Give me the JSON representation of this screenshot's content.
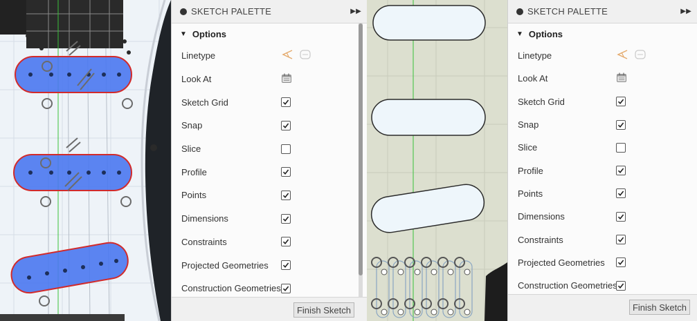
{
  "palette": {
    "title": "SKETCH PALETTE",
    "section": "Options",
    "finish_label": "Finish Sketch",
    "rows": [
      {
        "label": "Linetype",
        "type": "icons"
      },
      {
        "label": "Look At",
        "type": "icon"
      },
      {
        "label": "Sketch Grid",
        "type": "check",
        "checked": true
      },
      {
        "label": "Snap",
        "type": "check",
        "checked": true
      },
      {
        "label": "Slice",
        "type": "check",
        "checked": false
      },
      {
        "label": "Profile",
        "type": "check",
        "checked": true
      },
      {
        "label": "Points",
        "type": "check",
        "checked": true
      },
      {
        "label": "Dimensions",
        "type": "check",
        "checked": true
      },
      {
        "label": "Constraints",
        "type": "check",
        "checked": true
      },
      {
        "label": "Projected Geometries",
        "type": "check",
        "checked": true
      },
      {
        "label": "Construction Geometries",
        "type": "check",
        "checked": true
      }
    ]
  },
  "icons": {
    "header": "record-dot-icon",
    "expand": "double-chevron-right-icon",
    "linetype": "construction-line-icon",
    "linetype2": "centerline-icon",
    "look_at": "look-at-calendar-icon",
    "check": "checkmark-icon"
  },
  "colors": {
    "profile_fill": "#4a78f0",
    "profile_outline": "#d22a2a",
    "slot_fill": "#eef6fb",
    "canvas_bg_left": "#eef3f8",
    "canvas_bg_right": "#dcdfcf",
    "axis_green": "#39c03a"
  }
}
